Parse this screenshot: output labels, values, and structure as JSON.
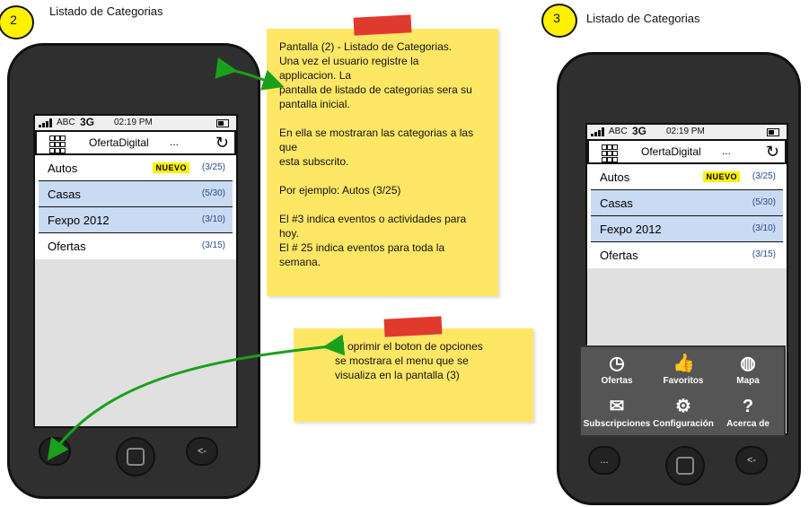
{
  "left": {
    "badge": "2",
    "title": "Listado de Categorias"
  },
  "right": {
    "badge": "3",
    "title": "Listado de Categorias"
  },
  "phone": {
    "status": {
      "carrier": "ABC",
      "network": "3G",
      "time": "02:19 PM"
    },
    "app_title": "OfertaDigital",
    "app_more": "...",
    "rows": [
      {
        "label": "Autos",
        "badge": "NUEVO",
        "count": "(3/25)"
      },
      {
        "label": "Casas",
        "badge": "",
        "count": "(5/30)"
      },
      {
        "label": "Fexpo 2012",
        "badge": "",
        "count": "(3/10)"
      },
      {
        "label": "Ofertas",
        "badge": "",
        "count": "(3/15)"
      }
    ],
    "buttons": {
      "menu": "...",
      "back": "<-"
    }
  },
  "menu": {
    "items": [
      {
        "label": "Ofertas",
        "icon": "clock-icon"
      },
      {
        "label": "Favoritos",
        "icon": "thumbs-up-icon"
      },
      {
        "label": "Mapa",
        "icon": "globe-icon"
      },
      {
        "label": "Subscripciones",
        "icon": "envelope-icon"
      },
      {
        "label": "Configuración",
        "icon": "gear-icon"
      },
      {
        "label": "Acerca de",
        "icon": "help-icon"
      }
    ]
  },
  "note1": {
    "lines": [
      "Pantalla (2) - Listado de Categorias.",
      "Una vez el usuario registre la",
      "applicacion. La",
      "pantalla de listado de categorias sera su",
      "pantalla inicial.",
      "",
      "En ella se mostraran las categorias a las",
      "que",
      "esta subscrito.",
      "",
      "Por ejemplo: Autos (3/25)",
      "",
      "El #3 indica eventos o actividades para",
      "hoy.",
      "El # 25 indica eventos para toda la",
      "semana."
    ]
  },
  "note2": {
    "lines": [
      "Al oprimir el boton de opciones",
      "se mostrara el menu que se",
      "visualiza en la pantalla (3)"
    ]
  },
  "colors": {
    "arrow": "#1aa01a",
    "note": "#ffe766",
    "tape": "#e03a2e",
    "highlight": "#c9daf3",
    "badge": "#fff200"
  }
}
